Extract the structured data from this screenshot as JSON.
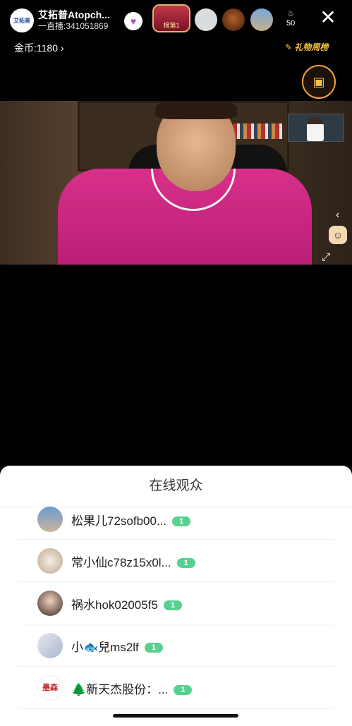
{
  "header": {
    "host_name": "艾拓普Atopch...",
    "host_id": "一直播:341051869",
    "avatar_text": "艾拓普",
    "rank_badge": "榜第1",
    "heat_value": "50",
    "coins": "金币:1180",
    "gift_rank": "礼物周榜"
  },
  "sheet": {
    "title": "在线观众",
    "viewers": [
      {
        "name": "松果儿72sofb00...",
        "level": "1"
      },
      {
        "name": "常小仙c78z15x0l...",
        "level": "1"
      },
      {
        "name": "祸水hok02005f5",
        "level": "1"
      },
      {
        "name": "小🐟兒ms2lf",
        "level": "1"
      },
      {
        "name": "🌲新天杰股份：...",
        "level": "1"
      }
    ],
    "seal_text": "墨森"
  }
}
